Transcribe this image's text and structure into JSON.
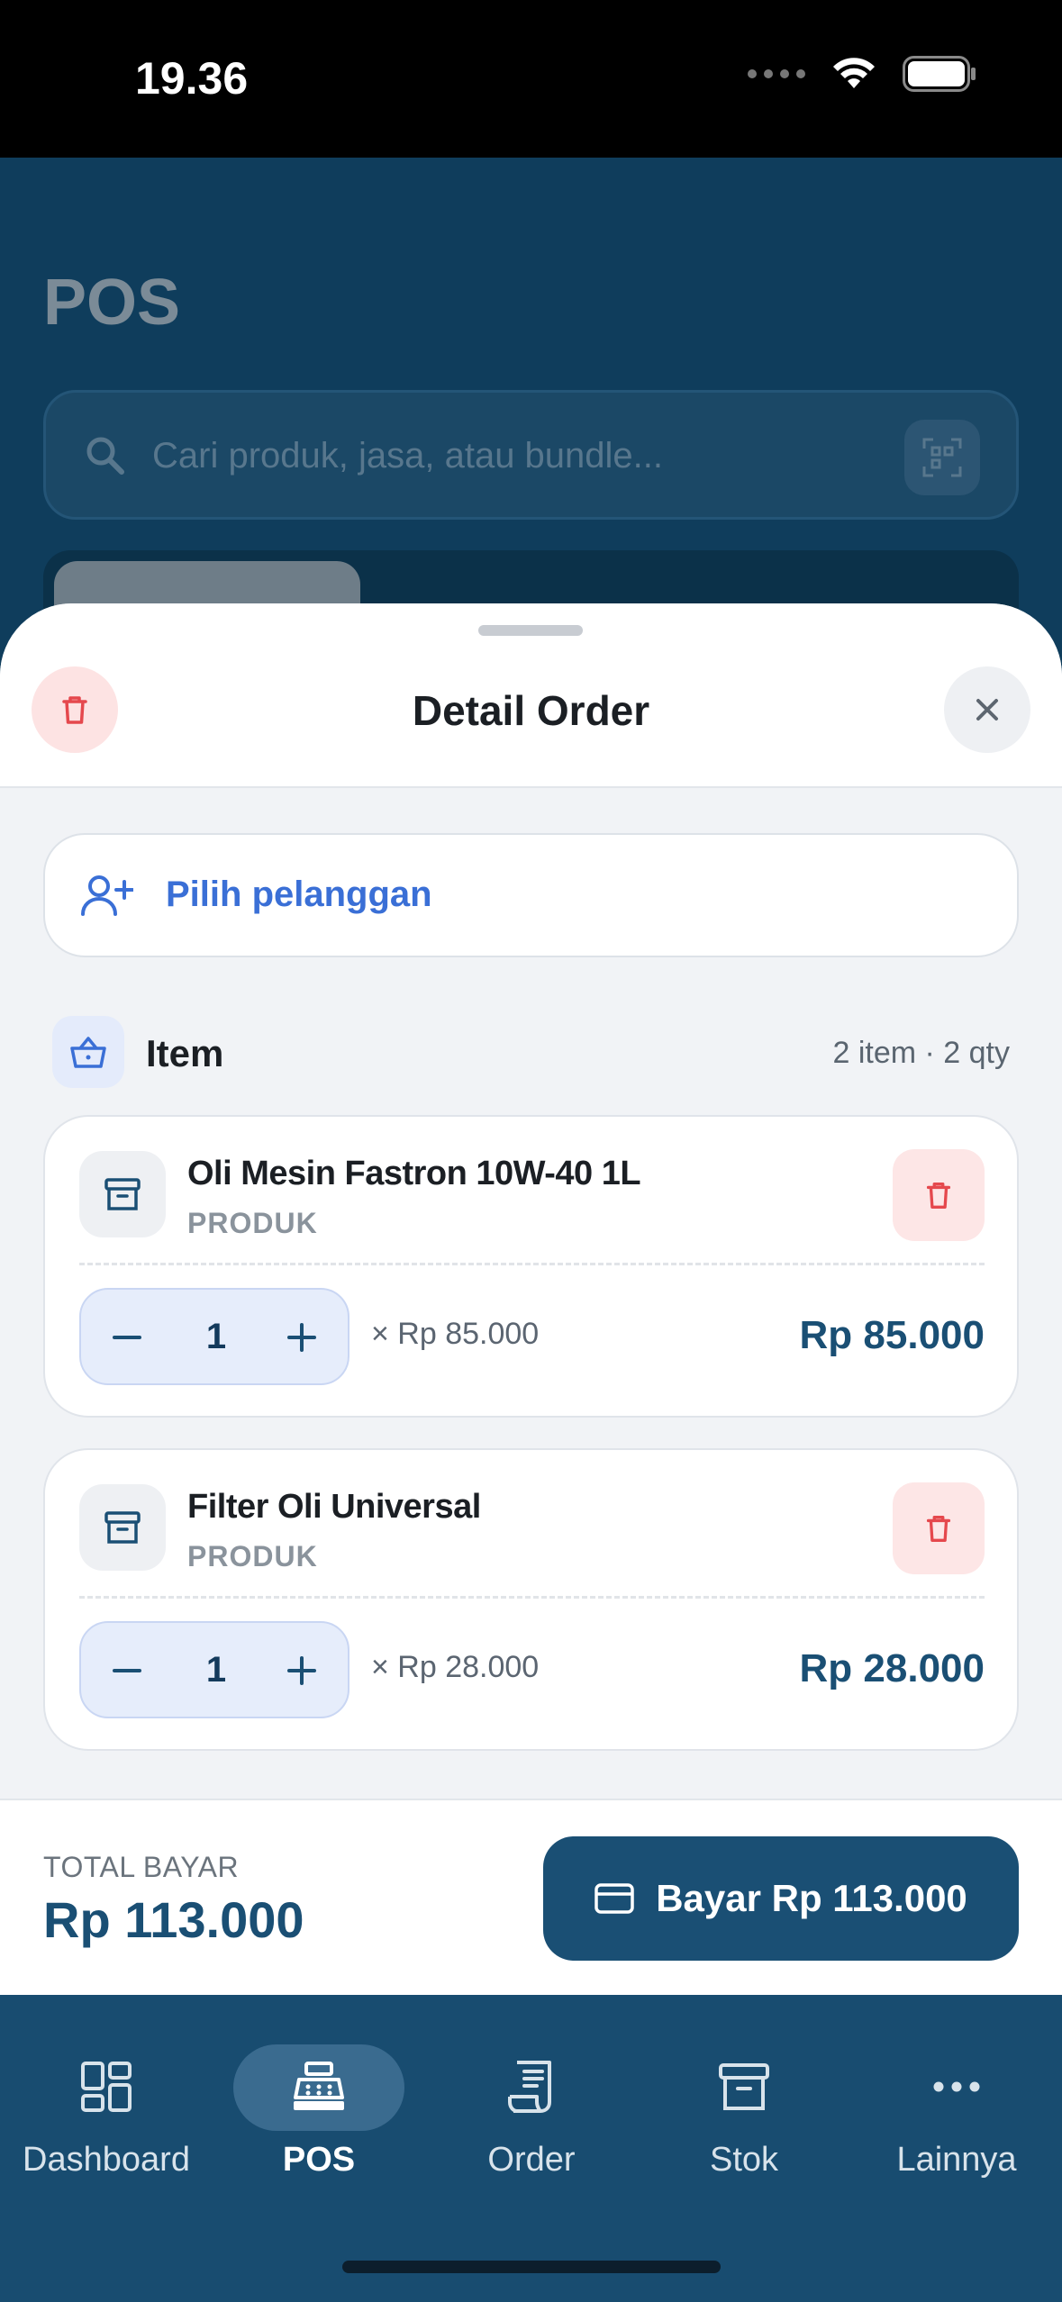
{
  "status": {
    "time": "19.36"
  },
  "background": {
    "title": "POS",
    "search_placeholder": "Cari produk, jasa, atau bundle..."
  },
  "sheet": {
    "title": "Detail Order",
    "customer_label": "Pilih pelanggan",
    "items_label": "Item",
    "items_count": "2 item · 2 qty",
    "items": [
      {
        "name": "Oli Mesin Fastron 10W-40 1L",
        "type": "PRODUK",
        "qty": "1",
        "unit_price": "× Rp 85.000",
        "total": "Rp 85.000"
      },
      {
        "name": "Filter Oli Universal",
        "type": "PRODUK",
        "qty": "1",
        "unit_price": "× Rp 28.000",
        "total": "Rp 28.000"
      }
    ]
  },
  "footer": {
    "total_label": "TOTAL BAYAR",
    "total_value": "Rp 113.000",
    "pay_label": "Bayar Rp 113.000"
  },
  "nav": [
    {
      "label": "Dashboard",
      "icon": "dashboard-icon"
    },
    {
      "label": "POS",
      "icon": "cash-register-icon",
      "active": true
    },
    {
      "label": "Order",
      "icon": "receipt-icon"
    },
    {
      "label": "Stok",
      "icon": "archive-icon"
    },
    {
      "label": "Lainnya",
      "icon": "more-icon"
    }
  ],
  "colors": {
    "primary": "#1a4f74",
    "link": "#3a6fd6",
    "danger": "#e5484d",
    "danger_bg": "#fde6e6"
  }
}
